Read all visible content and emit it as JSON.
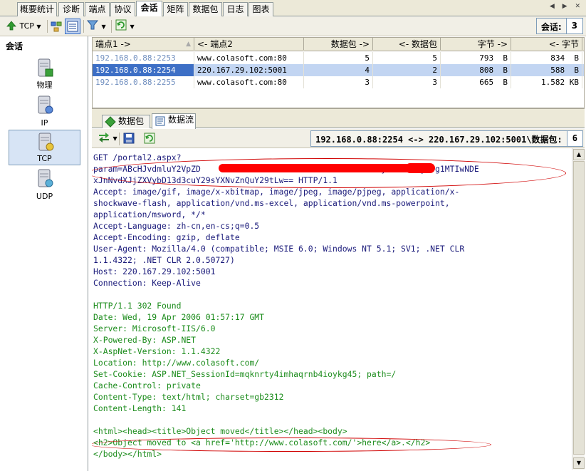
{
  "tabs": [
    {
      "label": "概要统计",
      "active": false
    },
    {
      "label": "诊断",
      "active": false
    },
    {
      "label": "端点",
      "active": false
    },
    {
      "label": "协议",
      "active": false
    },
    {
      "label": "会话",
      "active": true
    },
    {
      "label": "矩阵",
      "active": false
    },
    {
      "label": "数据包",
      "active": false
    },
    {
      "label": "日志",
      "active": false
    },
    {
      "label": "图表",
      "active": false
    }
  ],
  "toolbar": {
    "protocol_label": "TCP",
    "session_count_label": "会话:",
    "session_count_value": "3"
  },
  "left_panel": {
    "title": "会话",
    "items": [
      {
        "label": "物理",
        "icon": "server-icon",
        "selected": false
      },
      {
        "label": "IP",
        "icon": "server-icon",
        "selected": false
      },
      {
        "label": "TCP",
        "icon": "server-icon",
        "selected": true
      },
      {
        "label": "UDP",
        "icon": "server-icon",
        "selected": false
      }
    ]
  },
  "session_table": {
    "columns": [
      "端点1 ->",
      "<- 端点2",
      "数据包 ->",
      "<- 数据包",
      "字节 ->",
      "<- 字节"
    ],
    "rows": [
      {
        "ep1": "192.168.0.88:2253",
        "ep2": "www.colasoft.com:80",
        "pkt_out": "5",
        "pkt_in": "5",
        "bytes_out": "793  B",
        "bytes_in": "834  B",
        "selected": false
      },
      {
        "ep1": "192.168.0.88:2254",
        "ep2": "220.167.29.102:5001",
        "pkt_out": "4",
        "pkt_in": "2",
        "bytes_out": "808  B",
        "bytes_in": "588  B",
        "selected": true
      },
      {
        "ep1": "192.168.0.88:2255",
        "ep2": "www.colasoft.com:80",
        "pkt_out": "3",
        "pkt_in": "3",
        "bytes_out": "665  B",
        "bytes_in": "1.582 KB",
        "selected": false
      }
    ]
  },
  "sub_tabs": [
    {
      "label": "数据包",
      "active": false
    },
    {
      "label": "数据流",
      "active": true
    }
  ],
  "packet_info": {
    "label": "192.168.0.88:2254 <-> 220.167.29.102:5001\\数据包:",
    "value": "6"
  },
  "flow": {
    "request": "GET /portal2.aspx?\nparam=ABcHJvdmluY2VpZD                                  c2VybmFtZT1jZDg1MTIwNDE\nxJnNvdXJjZXVybD13d3cuY29sYXNvZnQuY29tLw== HTTP/1.1\nAccept: image/gif, image/x-xbitmap, image/jpeg, image/pjpeg, application/x-\nshockwave-flash, application/vnd.ms-excel, application/vnd.ms-powerpoint,\napplication/msword, */*\nAccept-Language: zh-cn,en-cs;q=0.5\nAccept-Encoding: gzip, deflate\nUser-Agent: Mozilla/4.0 (compatible; MSIE 6.0; Windows NT 5.1; SV1; .NET CLR\n1.1.4322; .NET CLR 2.0.50727)\nHost: 220.167.29.102:5001\nConnection: Keep-Alive",
    "response": "HTTP/1.1 302 Found\nDate: Wed, 19 Apr 2006 01:57:17 GMT\nServer: Microsoft-IIS/6.0\nX-Powered-By: ASP.NET\nX-AspNet-Version: 1.1.4322\nLocation: http://www.colasoft.com/\nSet-Cookie: ASP.NET_SessionId=mqknrty4imhaqrnb4ioykg45; path=/\nCache-Control: private\nContent-Type: text/html; charset=gb2312\nContent-Length: 141",
    "html_body": "<html><head><title>Object moved</title></head><body>\n<h2>Object moved to <a href='http://www.colasoft.com/'>here</a>.</h2>\n</body></html>"
  },
  "colors": {
    "request_text": "#1a1a7a",
    "response_text": "#1c8c1c",
    "annotation": "#d00000",
    "selection": "#c2d5f2"
  }
}
